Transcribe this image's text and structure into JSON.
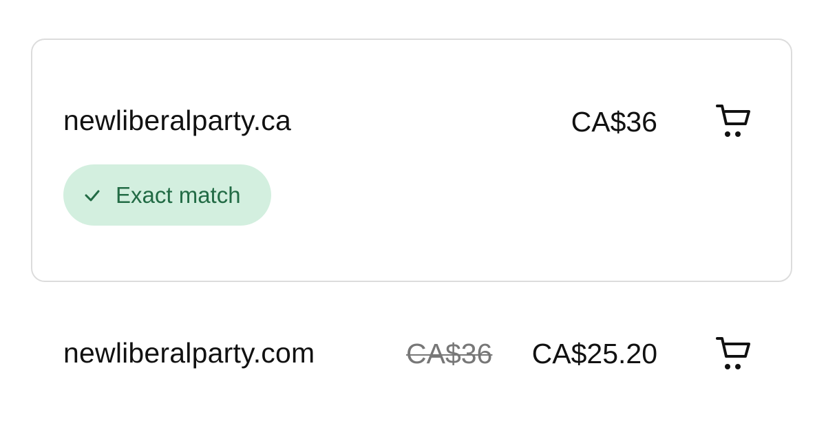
{
  "results": [
    {
      "domain": "newliberalparty.ca",
      "price": "CA$36",
      "badge": "Exact match",
      "cart_icon": "cart-icon"
    },
    {
      "domain": "newliberalparty.com",
      "original_price": "CA$36",
      "price": "CA$25.20",
      "cart_icon": "cart-icon"
    }
  ],
  "colors": {
    "badge_bg": "#d3efdf",
    "badge_text": "#226b45",
    "card_border": "#dcdcdc",
    "strike_text": "#777777"
  },
  "icons": {
    "badge_icon": "checkmark-icon"
  }
}
